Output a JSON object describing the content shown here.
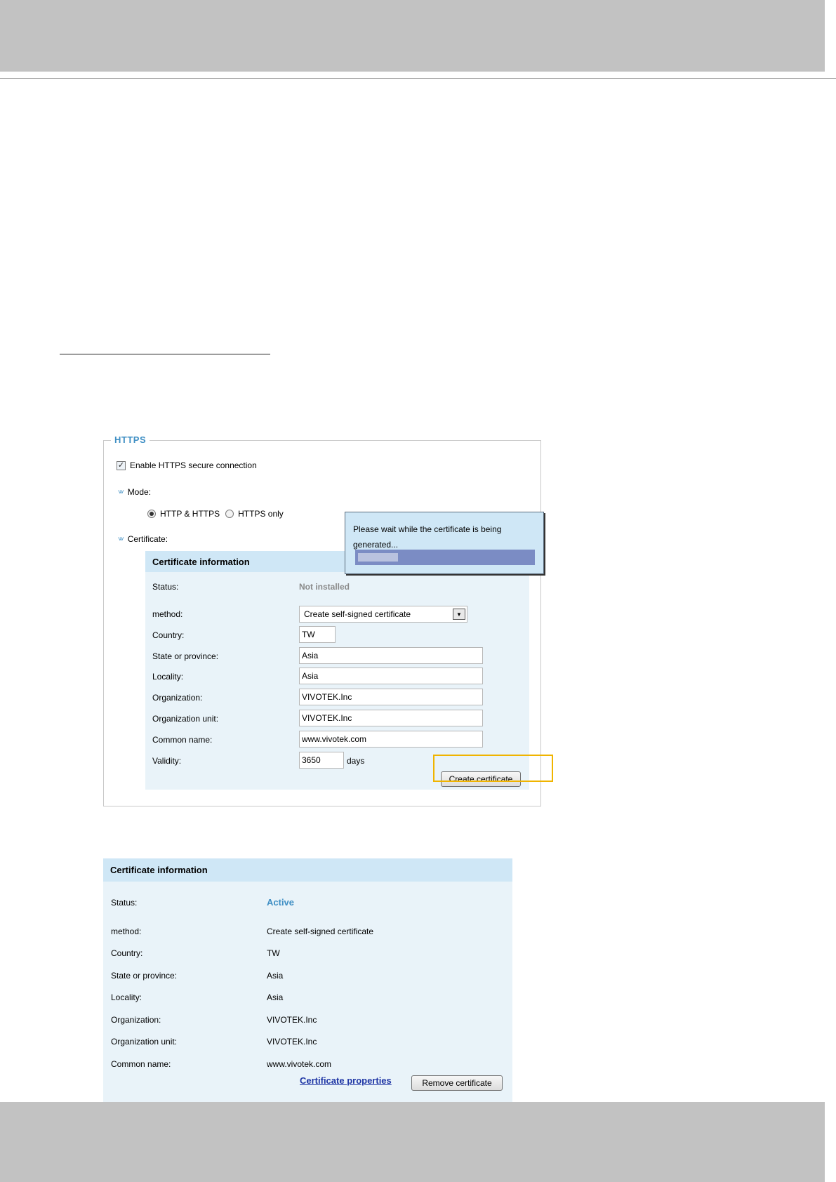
{
  "https": {
    "legend": "HTTPS",
    "enable_label": "Enable HTTPS secure connection",
    "enable_checked": true,
    "mode_label": "Mode:",
    "mode_options": [
      "HTTP & HTTPS",
      "HTTPS only"
    ],
    "mode_selected": "HTTP & HTTPS",
    "certificate_label": "Certificate:",
    "form": {
      "heading": "Certificate information",
      "status_label": "Status:",
      "status_value": "Not installed",
      "method_label": "method:",
      "method_value": "Create self-signed certificate",
      "country_label": "Country:",
      "country_value": "TW",
      "state_label": "State or province:",
      "state_value": "Asia",
      "locality_label": "Locality:",
      "locality_value": "Asia",
      "org_label": "Organization:",
      "org_value": "VIVOTEK.Inc",
      "org_unit_label": "Organization unit:",
      "org_unit_value": "VIVOTEK.Inc",
      "common_label": "Common name:",
      "common_value": "www.vivotek.com",
      "validity_label": "Validity:",
      "validity_value": "3650",
      "days_label": "days",
      "create_button": "Create certificate"
    }
  },
  "popup": {
    "message": "Please wait while the certificate is being generated...",
    "progress_percent": 23
  },
  "installed": {
    "heading": "Certificate information",
    "status_label": "Status:",
    "status_value": "Active",
    "method_label": "method:",
    "method_value": "Create self-signed certificate",
    "country_label": "Country:",
    "country_value": "TW",
    "state_label": "State or province:",
    "state_value": "Asia",
    "locality_label": "Locality:",
    "locality_value": "Asia",
    "org_label": "Organization:",
    "org_value": "VIVOTEK.Inc",
    "org_unit_label": "Organization unit:",
    "org_unit_value": "VIVOTEK.Inc",
    "common_label": "Common name:",
    "common_value": "www.vivotek.com",
    "properties_link": "Certificate properties",
    "remove_button": "Remove certificate"
  },
  "colors": {
    "accent": "#3f8fc4",
    "panel": "#e9f3f9",
    "panel_header": "#cfe7f6",
    "highlight": "#f0b400",
    "link": "#1f36a5"
  }
}
